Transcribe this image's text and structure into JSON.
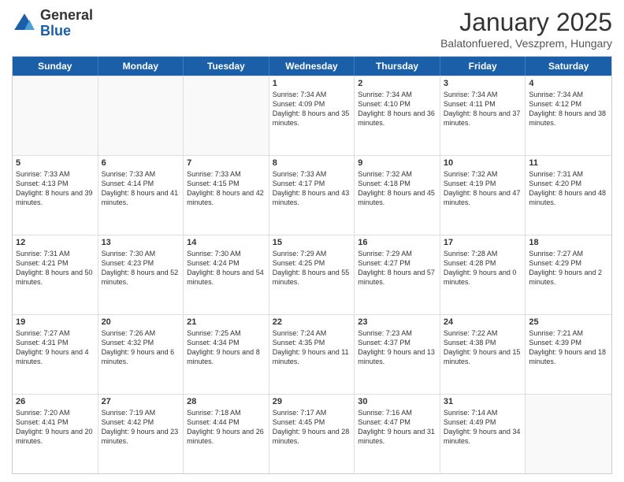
{
  "logo": {
    "general": "General",
    "blue": "Blue"
  },
  "title": "January 2025",
  "subtitle": "Balatonfuered, Veszprem, Hungary",
  "days": [
    "Sunday",
    "Monday",
    "Tuesday",
    "Wednesday",
    "Thursday",
    "Friday",
    "Saturday"
  ],
  "weeks": [
    [
      {
        "day": "",
        "info": ""
      },
      {
        "day": "",
        "info": ""
      },
      {
        "day": "",
        "info": ""
      },
      {
        "day": "1",
        "info": "Sunrise: 7:34 AM\nSunset: 4:09 PM\nDaylight: 8 hours and 35 minutes."
      },
      {
        "day": "2",
        "info": "Sunrise: 7:34 AM\nSunset: 4:10 PM\nDaylight: 8 hours and 36 minutes."
      },
      {
        "day": "3",
        "info": "Sunrise: 7:34 AM\nSunset: 4:11 PM\nDaylight: 8 hours and 37 minutes."
      },
      {
        "day": "4",
        "info": "Sunrise: 7:34 AM\nSunset: 4:12 PM\nDaylight: 8 hours and 38 minutes."
      }
    ],
    [
      {
        "day": "5",
        "info": "Sunrise: 7:33 AM\nSunset: 4:13 PM\nDaylight: 8 hours and 39 minutes."
      },
      {
        "day": "6",
        "info": "Sunrise: 7:33 AM\nSunset: 4:14 PM\nDaylight: 8 hours and 41 minutes."
      },
      {
        "day": "7",
        "info": "Sunrise: 7:33 AM\nSunset: 4:15 PM\nDaylight: 8 hours and 42 minutes."
      },
      {
        "day": "8",
        "info": "Sunrise: 7:33 AM\nSunset: 4:17 PM\nDaylight: 8 hours and 43 minutes."
      },
      {
        "day": "9",
        "info": "Sunrise: 7:32 AM\nSunset: 4:18 PM\nDaylight: 8 hours and 45 minutes."
      },
      {
        "day": "10",
        "info": "Sunrise: 7:32 AM\nSunset: 4:19 PM\nDaylight: 8 hours and 47 minutes."
      },
      {
        "day": "11",
        "info": "Sunrise: 7:31 AM\nSunset: 4:20 PM\nDaylight: 8 hours and 48 minutes."
      }
    ],
    [
      {
        "day": "12",
        "info": "Sunrise: 7:31 AM\nSunset: 4:21 PM\nDaylight: 8 hours and 50 minutes."
      },
      {
        "day": "13",
        "info": "Sunrise: 7:30 AM\nSunset: 4:23 PM\nDaylight: 8 hours and 52 minutes."
      },
      {
        "day": "14",
        "info": "Sunrise: 7:30 AM\nSunset: 4:24 PM\nDaylight: 8 hours and 54 minutes."
      },
      {
        "day": "15",
        "info": "Sunrise: 7:29 AM\nSunset: 4:25 PM\nDaylight: 8 hours and 55 minutes."
      },
      {
        "day": "16",
        "info": "Sunrise: 7:29 AM\nSunset: 4:27 PM\nDaylight: 8 hours and 57 minutes."
      },
      {
        "day": "17",
        "info": "Sunrise: 7:28 AM\nSunset: 4:28 PM\nDaylight: 9 hours and 0 minutes."
      },
      {
        "day": "18",
        "info": "Sunrise: 7:27 AM\nSunset: 4:29 PM\nDaylight: 9 hours and 2 minutes."
      }
    ],
    [
      {
        "day": "19",
        "info": "Sunrise: 7:27 AM\nSunset: 4:31 PM\nDaylight: 9 hours and 4 minutes."
      },
      {
        "day": "20",
        "info": "Sunrise: 7:26 AM\nSunset: 4:32 PM\nDaylight: 9 hours and 6 minutes."
      },
      {
        "day": "21",
        "info": "Sunrise: 7:25 AM\nSunset: 4:34 PM\nDaylight: 9 hours and 8 minutes."
      },
      {
        "day": "22",
        "info": "Sunrise: 7:24 AM\nSunset: 4:35 PM\nDaylight: 9 hours and 11 minutes."
      },
      {
        "day": "23",
        "info": "Sunrise: 7:23 AM\nSunset: 4:37 PM\nDaylight: 9 hours and 13 minutes."
      },
      {
        "day": "24",
        "info": "Sunrise: 7:22 AM\nSunset: 4:38 PM\nDaylight: 9 hours and 15 minutes."
      },
      {
        "day": "25",
        "info": "Sunrise: 7:21 AM\nSunset: 4:39 PM\nDaylight: 9 hours and 18 minutes."
      }
    ],
    [
      {
        "day": "26",
        "info": "Sunrise: 7:20 AM\nSunset: 4:41 PM\nDaylight: 9 hours and 20 minutes."
      },
      {
        "day": "27",
        "info": "Sunrise: 7:19 AM\nSunset: 4:42 PM\nDaylight: 9 hours and 23 minutes."
      },
      {
        "day": "28",
        "info": "Sunrise: 7:18 AM\nSunset: 4:44 PM\nDaylight: 9 hours and 26 minutes."
      },
      {
        "day": "29",
        "info": "Sunrise: 7:17 AM\nSunset: 4:45 PM\nDaylight: 9 hours and 28 minutes."
      },
      {
        "day": "30",
        "info": "Sunrise: 7:16 AM\nSunset: 4:47 PM\nDaylight: 9 hours and 31 minutes."
      },
      {
        "day": "31",
        "info": "Sunrise: 7:14 AM\nSunset: 4:49 PM\nDaylight: 9 hours and 34 minutes."
      },
      {
        "day": "",
        "info": ""
      }
    ]
  ]
}
